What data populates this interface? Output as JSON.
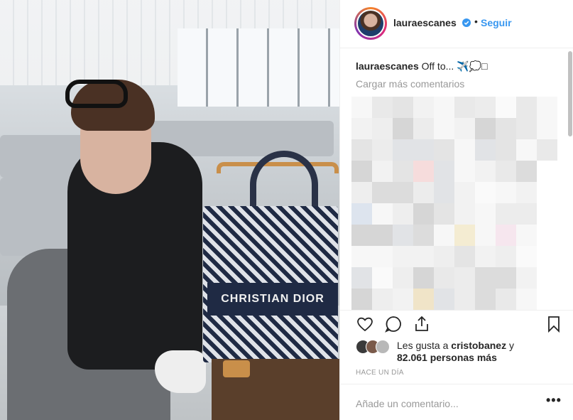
{
  "post": {
    "photo_alt": "Photo of woman in airport with Christian Dior bag",
    "bag_text": "CHRISTIAN DIOR"
  },
  "header": {
    "username": "lauraescanes",
    "separator": "•",
    "follow_label": "Seguir",
    "verified_icon": "verified-badge-icon"
  },
  "caption": {
    "username": "lauraescanes",
    "text": "Off to... ✈️💭□"
  },
  "comments": {
    "load_more_label": "Cargar más comentarios"
  },
  "actions": {
    "like_icon": "heart-icon",
    "comment_icon": "comment-icon",
    "share_icon": "share-icon",
    "save_icon": "bookmark-icon"
  },
  "likes": {
    "prefix": "Les gusta a",
    "user": "cristobanez",
    "conj": "y",
    "count_text": "82.061 personas más"
  },
  "timestamp": "HACE UN DÍA",
  "comment_box": {
    "placeholder": "Añade un comentario...",
    "more_label": "•••"
  },
  "colors": {
    "accent": "#3897f0",
    "text": "#262626",
    "muted": "#999999",
    "border": "#efefef"
  }
}
